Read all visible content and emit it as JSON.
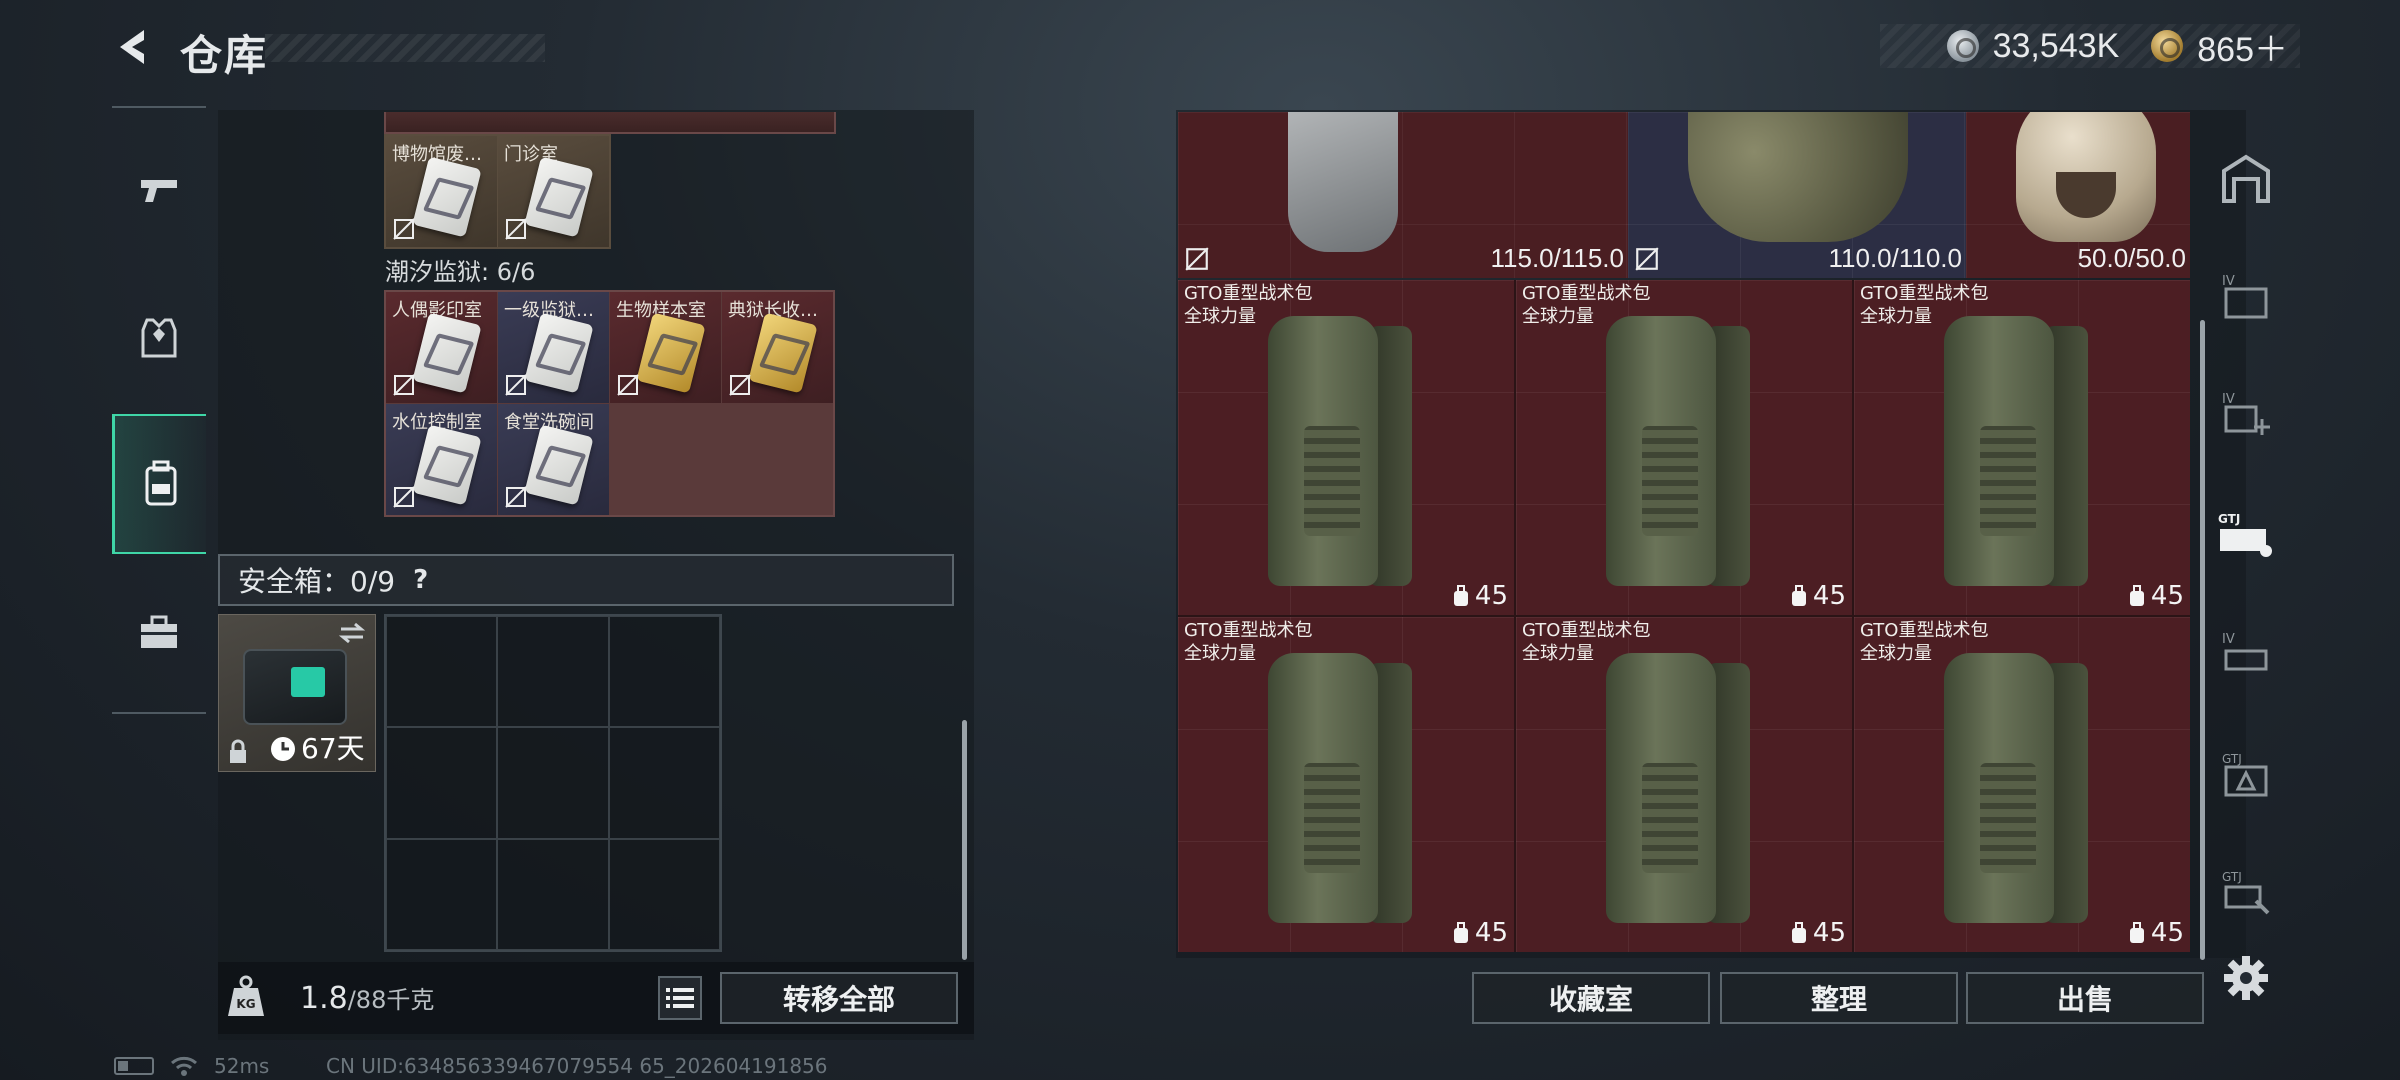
{
  "header": {
    "title": "仓库",
    "currency_silver": "33,543K",
    "currency_gold": "865＋"
  },
  "left_nav": {
    "items": [
      {
        "name": "weapons",
        "icon": "pistol-icon"
      },
      {
        "name": "equipment",
        "icon": "vest-icon"
      },
      {
        "name": "backpack",
        "icon": "backpack-icon",
        "active": true
      },
      {
        "name": "toolbox",
        "icon": "toolbox-icon"
      }
    ]
  },
  "keycards_top": [
    {
      "label": "博物馆废…",
      "color": "tan",
      "card": "white"
    },
    {
      "label": "门诊室",
      "color": "tan",
      "card": "white"
    }
  ],
  "prison": {
    "label": "潮汐监狱: 6/6",
    "cards": [
      {
        "label": "人偶影印室",
        "color": "red",
        "card": "white"
      },
      {
        "label": "一级监狱…",
        "color": "purple",
        "card": "white"
      },
      {
        "label": "生物样本室",
        "color": "red",
        "card": "gold"
      },
      {
        "label": "典狱长收…",
        "color": "red",
        "card": "gold"
      },
      {
        "label": "水位控制室",
        "color": "purple",
        "card": "white"
      },
      {
        "label": "食堂洗碗间",
        "color": "purple",
        "card": "white"
      }
    ]
  },
  "safebox": {
    "label": "安全箱：0/9",
    "help": "?",
    "days_left": "67天"
  },
  "weight": {
    "current": "1.8",
    "max": "/88千克"
  },
  "buttons": {
    "transfer_all": "转移全部",
    "collection": "收藏室",
    "tidy": "整理",
    "sell": "出售"
  },
  "armor_row": [
    {
      "durability": "115.0/115.0",
      "kind": "gray-vest"
    },
    {
      "durability": "110.0/110.0",
      "kind": "camo-vest"
    },
    {
      "durability": "50.0/50.0",
      "kind": "helmet"
    }
  ],
  "bags": [
    {
      "name": "GTO重型战术包",
      "brand": "全球力量",
      "count": "45"
    },
    {
      "name": "GTO重型战术包",
      "brand": "全球力量",
      "count": "45"
    },
    {
      "name": "GTO重型战术包",
      "brand": "全球力量",
      "count": "45"
    },
    {
      "name": "GTO重型战术包",
      "brand": "全球力量",
      "count": "45"
    },
    {
      "name": "GTO重型战术包",
      "brand": "全球力量",
      "count": "45"
    },
    {
      "name": "GTO重型战术包",
      "brand": "全球力量",
      "count": "45"
    }
  ],
  "right_rail": {
    "items": [
      "storage-room-icon",
      "tier4-box-icon",
      "tier4-medkit-icon",
      "gtj-case-icon",
      "tier4-rack-icon",
      "gtj-warning-icon",
      "gtj-tool-icon"
    ],
    "labels": [
      "IV",
      "IV",
      "GTJ",
      "IV",
      "GTJ",
      "GTJ"
    ]
  },
  "status": {
    "ping": "52ms",
    "uid": "CN UID:634856339467079554 65_202604191856"
  },
  "colors": {
    "accent": "#3fd6a7",
    "bag_bg": "#4c1e23",
    "navy_bg": "#2c2e44"
  }
}
